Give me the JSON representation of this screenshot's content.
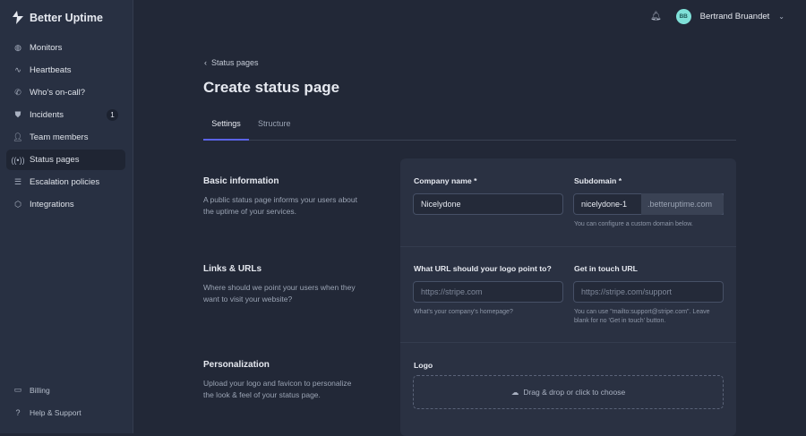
{
  "app": {
    "name": "Better Uptime"
  },
  "sidebar": {
    "items": [
      {
        "label": "Monitors",
        "icon": "globe-icon"
      },
      {
        "label": "Heartbeats",
        "icon": "pulse-icon"
      },
      {
        "label": "Who's on-call?",
        "icon": "phone-icon"
      },
      {
        "label": "Incidents",
        "icon": "shield-icon",
        "badge": "1"
      },
      {
        "label": "Team members",
        "icon": "user-icon"
      },
      {
        "label": "Status pages",
        "icon": "broadcast-icon",
        "active": true
      },
      {
        "label": "Escalation policies",
        "icon": "list-icon"
      },
      {
        "label": "Integrations",
        "icon": "puzzle-icon"
      }
    ],
    "bottom": [
      {
        "label": "Billing",
        "icon": "card-icon"
      },
      {
        "label": "Help & Support",
        "icon": "help-icon"
      }
    ]
  },
  "header": {
    "user_initials": "BB",
    "user_name": "Bertrand Bruandet"
  },
  "breadcrumb": "Status pages",
  "page_title": "Create status page",
  "tabs": [
    "Settings",
    "Structure"
  ],
  "sections": [
    {
      "title": "Basic information",
      "desc": "A public status page informs your users about the uptime of your services."
    },
    {
      "title": "Links & URLs",
      "desc": "Where should we point your users when they want to visit your website?"
    },
    {
      "title": "Personalization",
      "desc": "Upload your logo and favicon to personalize the look & feel of your status page."
    }
  ],
  "form": {
    "company_label": "Company name *",
    "company_value": "Nicelydone",
    "subdomain_label": "Subdomain *",
    "subdomain_value": "nicelydone-1",
    "subdomain_suffix": ".betteruptime.com",
    "subdomain_help": "You can configure a custom domain below.",
    "logo_url_label": "What URL should your logo point to?",
    "logo_url_placeholder": "https://stripe.com",
    "logo_url_help": "What's your company's homepage?",
    "contact_label": "Get in touch URL",
    "contact_placeholder": "https://stripe.com/support",
    "contact_help": "You can use \"mailto:support@stripe.com\". Leave blank for no 'Get in touch' button.",
    "logo_label": "Logo",
    "logo_drop": "Drag & drop or click to choose"
  }
}
